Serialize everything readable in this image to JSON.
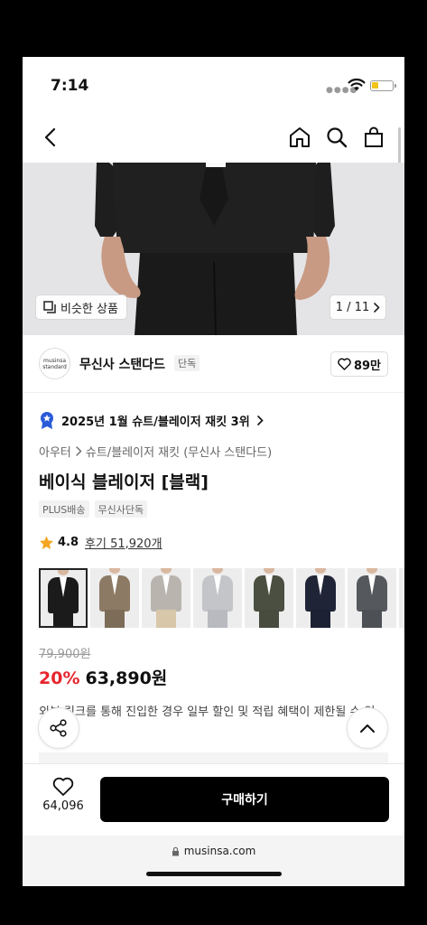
{
  "status_bar": {
    "time": "7:14"
  },
  "product_image": {
    "similar_label": "비슷한 상품",
    "counter": "1 / 11"
  },
  "brand": {
    "logo_text_line1": "musinsa",
    "logo_text_line2": "standard",
    "name": "무신사 스탠다드",
    "badge": "단독",
    "like_count": "89만"
  },
  "ranking": {
    "text": "2025년 1월 슈트/블레이저 재킷 3위"
  },
  "breadcrumb": {
    "level1": "아우터",
    "level2": "슈트/블레이저 재킷 (무신사 스탠다드)"
  },
  "product": {
    "title": "베이식 블레이저 [블랙]",
    "tags": [
      "PLUS배송",
      "무신사단독"
    ],
    "rating": "4.8",
    "review_link": "후기 51,920개"
  },
  "swatches": [
    {
      "name": "black",
      "jacket": "#1b1b1b",
      "legs": "#1b1b1b",
      "selected": true
    },
    {
      "name": "beige",
      "jacket": "#8c7a64",
      "legs": "#7d6c58",
      "selected": false
    },
    {
      "name": "light-gray",
      "jacket": "#b9b5ae",
      "legs": "#d8c7a8",
      "selected": false
    },
    {
      "name": "pale-gray",
      "jacket": "#c3c5c9",
      "legs": "#b8babf",
      "selected": false
    },
    {
      "name": "olive",
      "jacket": "#4a4f41",
      "legs": "#474c3e",
      "selected": false
    },
    {
      "name": "navy",
      "jacket": "#1f2436",
      "legs": "#1c2133",
      "selected": false
    },
    {
      "name": "charcoal",
      "jacket": "#55585d",
      "legs": "#4d5055",
      "selected": false
    },
    {
      "name": "gray",
      "jacket": "#a3a3a3",
      "legs": "#999999",
      "selected": false
    }
  ],
  "price": {
    "original": "79,900원",
    "discount": "20%",
    "sale": "63,890원",
    "notice": "외부 링크를 통해 진입한 경우 일부 할인 및 적립 혜택이 제한될 수 있"
  },
  "purchase_bar": {
    "wish_count": "64,096",
    "buy_label": "구매하기"
  },
  "browser": {
    "url": "musinsa.com"
  },
  "colors": {
    "discount": "#e6262e",
    "buy_button": "#000000",
    "rank_badge": "#2a5bd7"
  }
}
